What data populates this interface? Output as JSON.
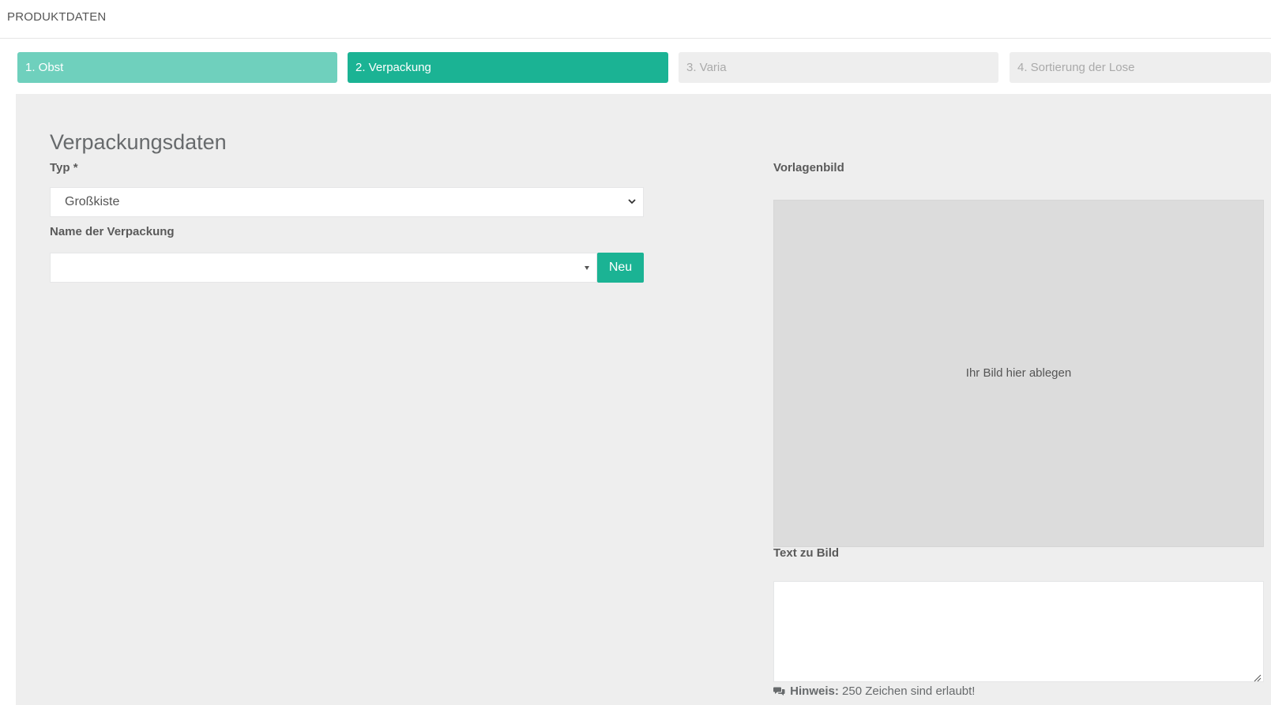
{
  "header": {
    "title": "PRODUKTDATEN"
  },
  "steps": [
    {
      "label": "1. Obst",
      "state": "done"
    },
    {
      "label": "2. Verpackung",
      "state": "active"
    },
    {
      "label": "3. Varia",
      "state": "todo"
    },
    {
      "label": "4. Sortierung der Lose",
      "state": "todo"
    }
  ],
  "form": {
    "heading": "Verpackungsdaten",
    "type_label": "Typ *",
    "type_value": "Großkiste",
    "name_label": "Name der Verpackung",
    "name_value": "",
    "new_button": "Neu"
  },
  "image": {
    "label": "Vorlagenbild",
    "dropzone_text": "Ihr Bild hier ablegen",
    "text_label": "Text zu Bild",
    "text_value": "",
    "hint_label": "Hinweis:",
    "hint_text": " 250 Zeichen sind erlaubt!"
  },
  "colors": {
    "accent": "#1bb394",
    "done": "#6fd0bd",
    "todo": "#eeeeee",
    "panel": "#eeeeee",
    "dropzone": "#dcdcdc"
  },
  "icons": {
    "select": "chevron-down-icon",
    "combo": "caret-down-icon",
    "hint": "comments-icon",
    "textarea": "resize-handle-icon"
  }
}
